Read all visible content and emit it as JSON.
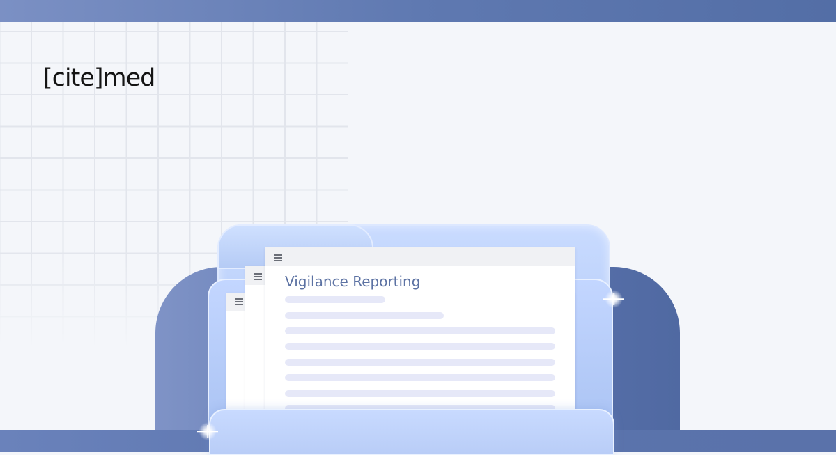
{
  "brand": {
    "logo_text": "[cite]med"
  },
  "document": {
    "title": "Vigilance Reporting"
  },
  "colors": {
    "top_bar": "#6a82bb",
    "arch": "#5a72aa",
    "folder": "#b9cdf7",
    "title_text": "#5c72a3",
    "placeholder_line": "#e6e8f8"
  },
  "icons": [
    "menu-icon",
    "menu-icon",
    "menu-icon"
  ]
}
